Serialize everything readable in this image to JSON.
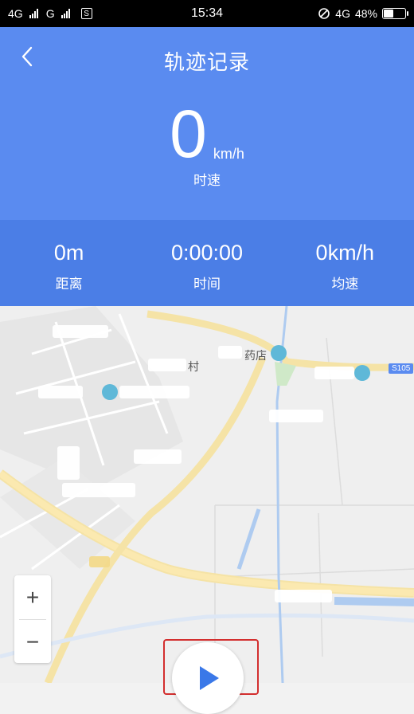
{
  "status_bar": {
    "network1": "4G",
    "network2": "G",
    "sim_icon": "S",
    "time": "15:34",
    "network3": "4G",
    "battery": "48%",
    "battery_level": 0.48
  },
  "header": {
    "title": "轨迹记录",
    "speed_value": "0",
    "speed_unit": "km/h",
    "speed_label": "时速"
  },
  "stats": [
    {
      "value": "0m",
      "label": "距离"
    },
    {
      "value": "0:00:00",
      "label": "时间"
    },
    {
      "value": "0km/h",
      "label": "均速"
    }
  ],
  "map": {
    "poi_pharmacy": "药店",
    "poi_village": "村",
    "road_tag": "S105"
  },
  "zoom": {
    "in": "+",
    "out": "−"
  },
  "colors": {
    "primary": "#5a8bf0",
    "stats_bg": "#4b7ee6",
    "highlight": "#d32f2f"
  }
}
